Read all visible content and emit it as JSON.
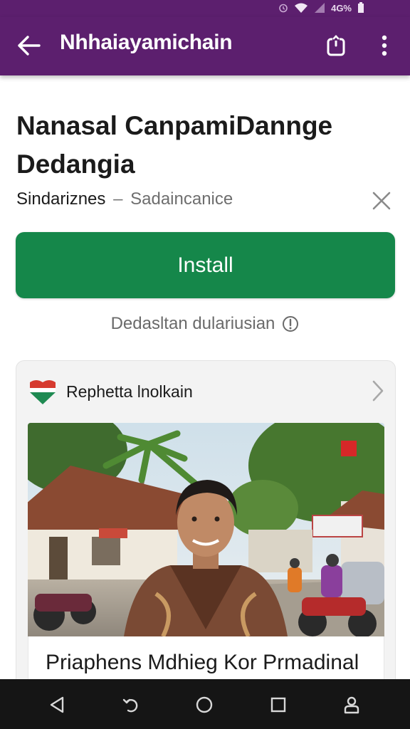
{
  "status_bar": {
    "network": "4G%"
  },
  "app_bar": {
    "title": "Nhhaiayamichain",
    "back_icon": "arrow-left-icon",
    "share_icon": "share-icon",
    "more_icon": "more-vert-icon",
    "color": "#5c1f6e"
  },
  "app": {
    "title": "Nanasal CanpamiDannge Dedangia",
    "publisher": "Sindariznes",
    "separator": "–",
    "category": "Sadaincanice",
    "close_icon": "close-icon"
  },
  "install": {
    "label": "Install",
    "color": "#15874a"
  },
  "disclaimer": {
    "text": "Dedasltan dulariusian",
    "icon": "info-icon"
  },
  "news_card": {
    "source": "Rephetta lnolkain",
    "source_icon": "flag-logo-icon",
    "chevron_icon": "chevron-right-icon",
    "headline": "Priaphens Mdhieg Kor Prmadinal"
  },
  "nav_bar": {
    "back_icon": "nav-back-icon",
    "undo_icon": "nav-undo-icon",
    "home_icon": "nav-home-icon",
    "recents_icon": "nav-recents-icon",
    "profile_icon": "nav-profile-icon"
  }
}
